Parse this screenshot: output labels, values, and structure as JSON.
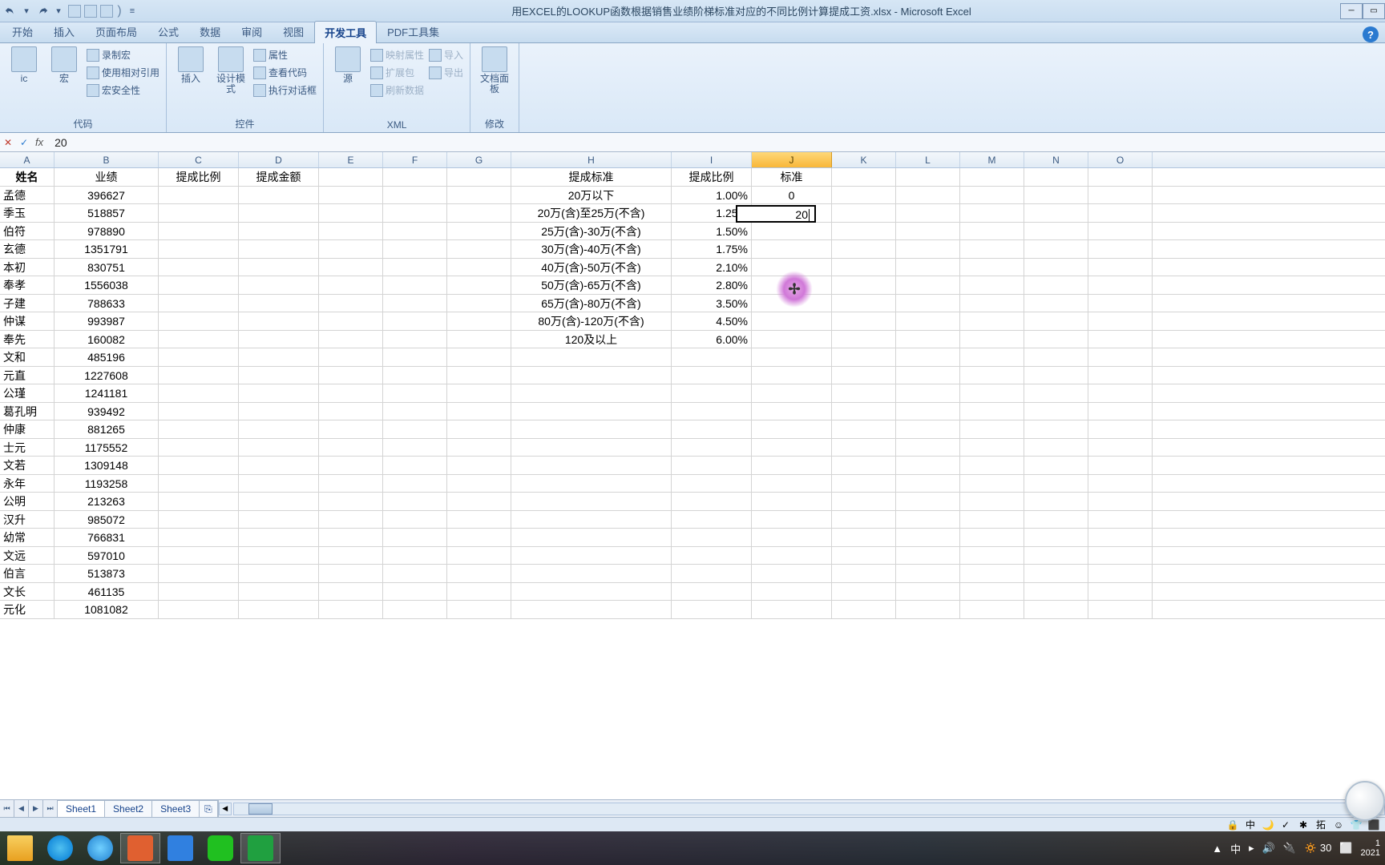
{
  "title": "用EXCEL的LOOKUP函数根据销售业绩阶梯标准对应的不同比例计算提成工资.xlsx - Microsoft Excel",
  "tabs": [
    "开始",
    "插入",
    "页面布局",
    "公式",
    "数据",
    "审阅",
    "视图",
    "开发工具",
    "PDF工具集"
  ],
  "active_tab": 7,
  "ribbon": {
    "groups": [
      {
        "label": "代码",
        "big": [
          {
            "lbl": "ic"
          },
          {
            "lbl": "宏"
          }
        ],
        "items": [
          "录制宏",
          "使用相对引用",
          "宏安全性"
        ]
      },
      {
        "label": "控件",
        "big": [
          {
            "lbl": "插入"
          },
          {
            "lbl": "设计模式"
          }
        ],
        "items": [
          "属性",
          "查看代码",
          "执行对话框"
        ]
      },
      {
        "label": "XML",
        "big": [
          {
            "lbl": "源"
          }
        ],
        "items": [
          "映射属性",
          "扩展包",
          "刷新数据"
        ],
        "items2": [
          "导入",
          "导出"
        ]
      },
      {
        "label": "修改",
        "big": [
          {
            "lbl": "文档面板"
          }
        ]
      }
    ]
  },
  "formula_value": "20",
  "columns": [
    "A",
    "B",
    "C",
    "D",
    "E",
    "F",
    "G",
    "H",
    "I",
    "J",
    "K",
    "L",
    "M",
    "N",
    "O"
  ],
  "selected_col": "J",
  "headers": {
    "A": "姓名",
    "B": "业绩",
    "C": "提成比例",
    "D": "提成金额",
    "H": "提成标准",
    "I": "提成比例",
    "J": "标准"
  },
  "rows": [
    {
      "A": "孟德",
      "B": "396627",
      "H": "20万以下",
      "I": "1.00%",
      "J": "0"
    },
    {
      "A": "季玉",
      "B": "518857",
      "H": "20万(含)至25万(不含)",
      "I": "1.25%",
      "J": "20"
    },
    {
      "A": "伯符",
      "B": "978890",
      "H": "25万(含)-30万(不含)",
      "I": "1.50%"
    },
    {
      "A": "玄德",
      "B": "1351791",
      "H": "30万(含)-40万(不含)",
      "I": "1.75%"
    },
    {
      "A": "本初",
      "B": "830751",
      "H": "40万(含)-50万(不含)",
      "I": "2.10%"
    },
    {
      "A": "奉孝",
      "B": "1556038",
      "H": "50万(含)-65万(不含)",
      "I": "2.80%"
    },
    {
      "A": "子建",
      "B": "788633",
      "H": "65万(含)-80万(不含)",
      "I": "3.50%"
    },
    {
      "A": "仲谋",
      "B": "993987",
      "H": "80万(含)-120万(不含)",
      "I": "4.50%"
    },
    {
      "A": "奉先",
      "B": "160082",
      "H": "120及以上",
      "I": "6.00%"
    },
    {
      "A": "文和",
      "B": "485196"
    },
    {
      "A": "元直",
      "B": "1227608"
    },
    {
      "A": "公瑾",
      "B": "1241181"
    },
    {
      "A": "葛孔明",
      "B": "939492"
    },
    {
      "A": "仲康",
      "B": "881265"
    },
    {
      "A": "士元",
      "B": "1175552"
    },
    {
      "A": "文若",
      "B": "1309148"
    },
    {
      "A": "永年",
      "B": "1193258"
    },
    {
      "A": "公明",
      "B": "213263"
    },
    {
      "A": "汉升",
      "B": "985072"
    },
    {
      "A": "幼常",
      "B": "766831"
    },
    {
      "A": "文远",
      "B": "597010"
    },
    {
      "A": "伯言",
      "B": "513873"
    },
    {
      "A": "文长",
      "B": "461135"
    },
    {
      "A": "元化",
      "B": "1081082"
    }
  ],
  "sheets": [
    "Sheet1",
    "Sheet2",
    "Sheet3"
  ],
  "active_sheet": 0,
  "active_cell_value": "20",
  "tray": {
    "ime": "中",
    "temp": "30",
    "time1": "1",
    "time2": "2021"
  },
  "status_icons": [
    "🔒",
    "中",
    "🌙",
    "✓",
    "✱",
    "拓",
    "☺",
    "👕",
    "⬛"
  ]
}
